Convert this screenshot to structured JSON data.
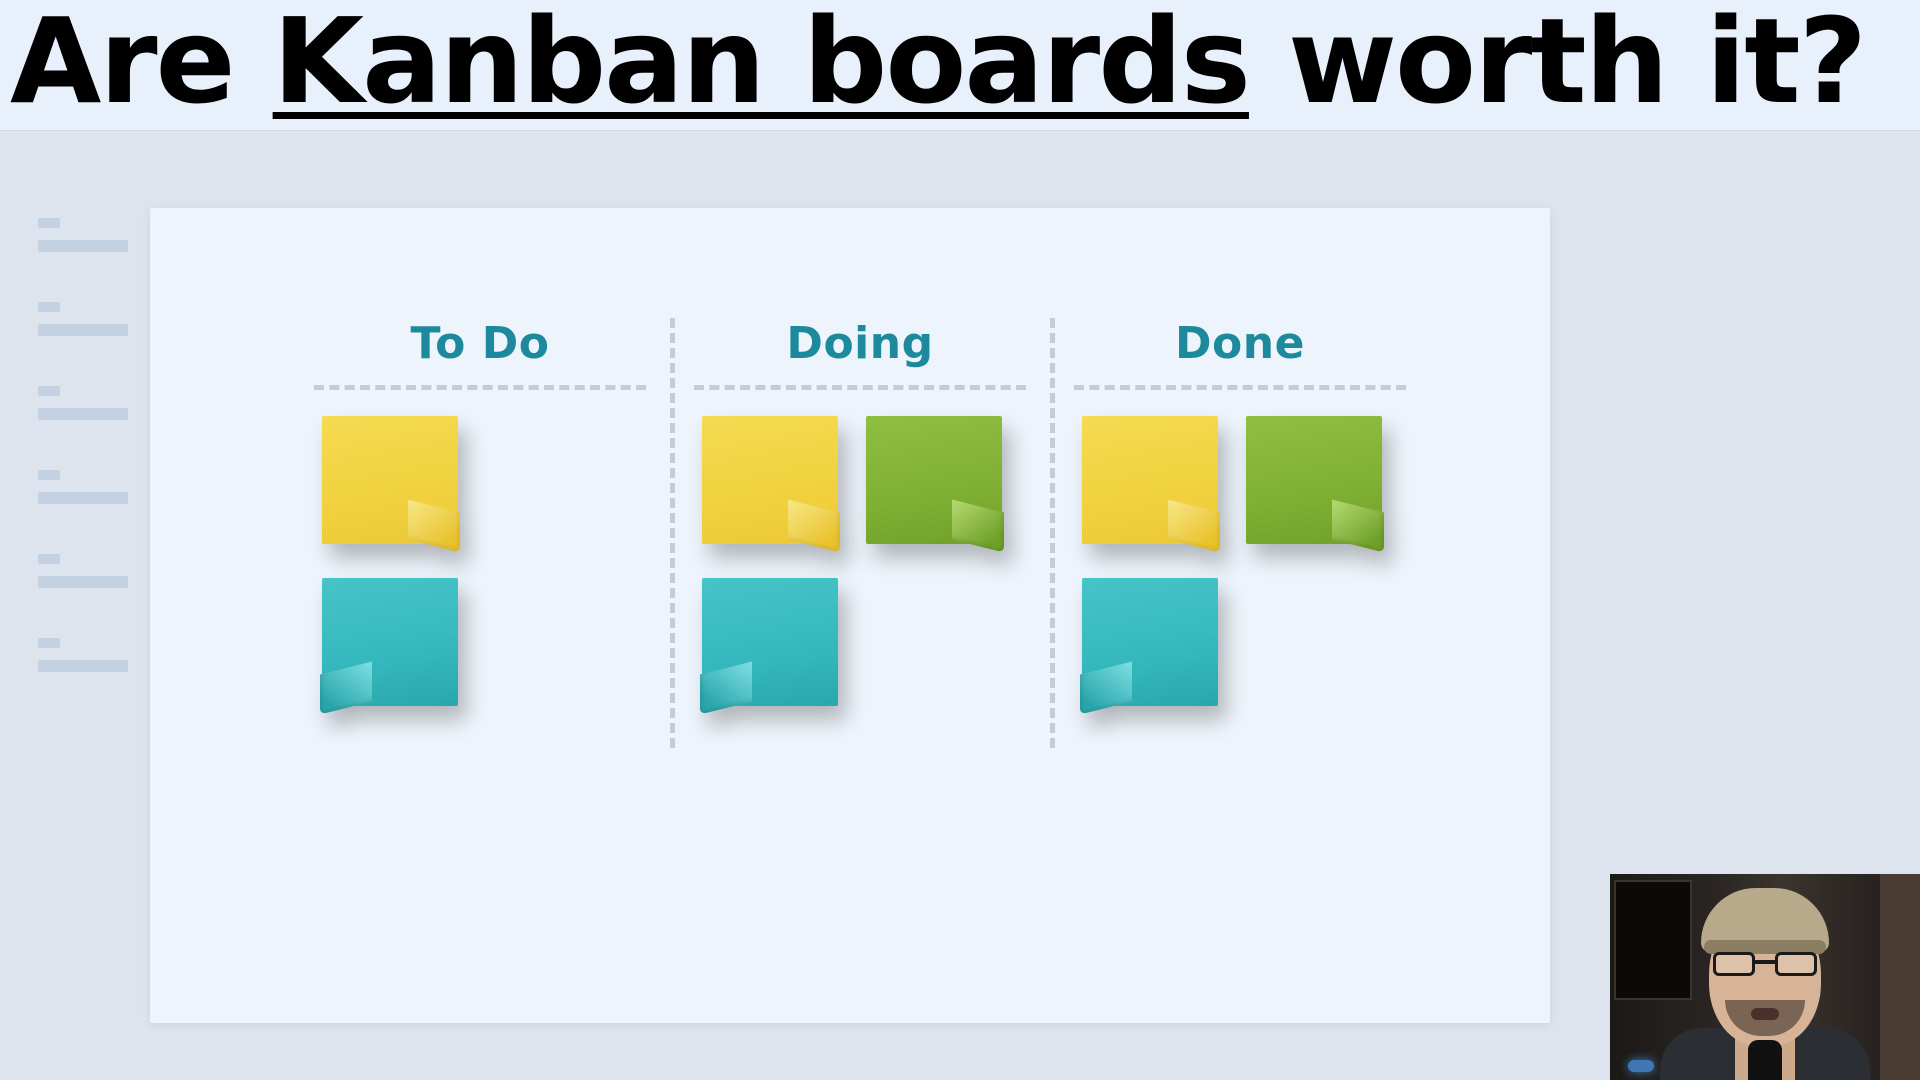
{
  "title": {
    "pre": "Are ",
    "underlined": "Kanban boards",
    "post": " worth it?"
  },
  "board": {
    "columns": [
      {
        "label": "To Do",
        "notes": [
          [
            "yellow"
          ],
          [
            "teal"
          ]
        ]
      },
      {
        "label": "Doing",
        "notes": [
          [
            "yellow",
            "green"
          ],
          [
            "teal"
          ]
        ]
      },
      {
        "label": "Done",
        "notes": [
          [
            "yellow",
            "green"
          ],
          [
            "teal"
          ]
        ]
      }
    ]
  },
  "sidebar_placeholder_rows": 6,
  "colors": {
    "title_bg": "#e8f0fb",
    "stage_bg": "#dde4ed",
    "board_bg": "#edf4fb",
    "column_header": "#1c8a9c",
    "note_yellow": "#f1d23f",
    "note_green": "#7fb033",
    "note_teal": "#35b8bd"
  }
}
